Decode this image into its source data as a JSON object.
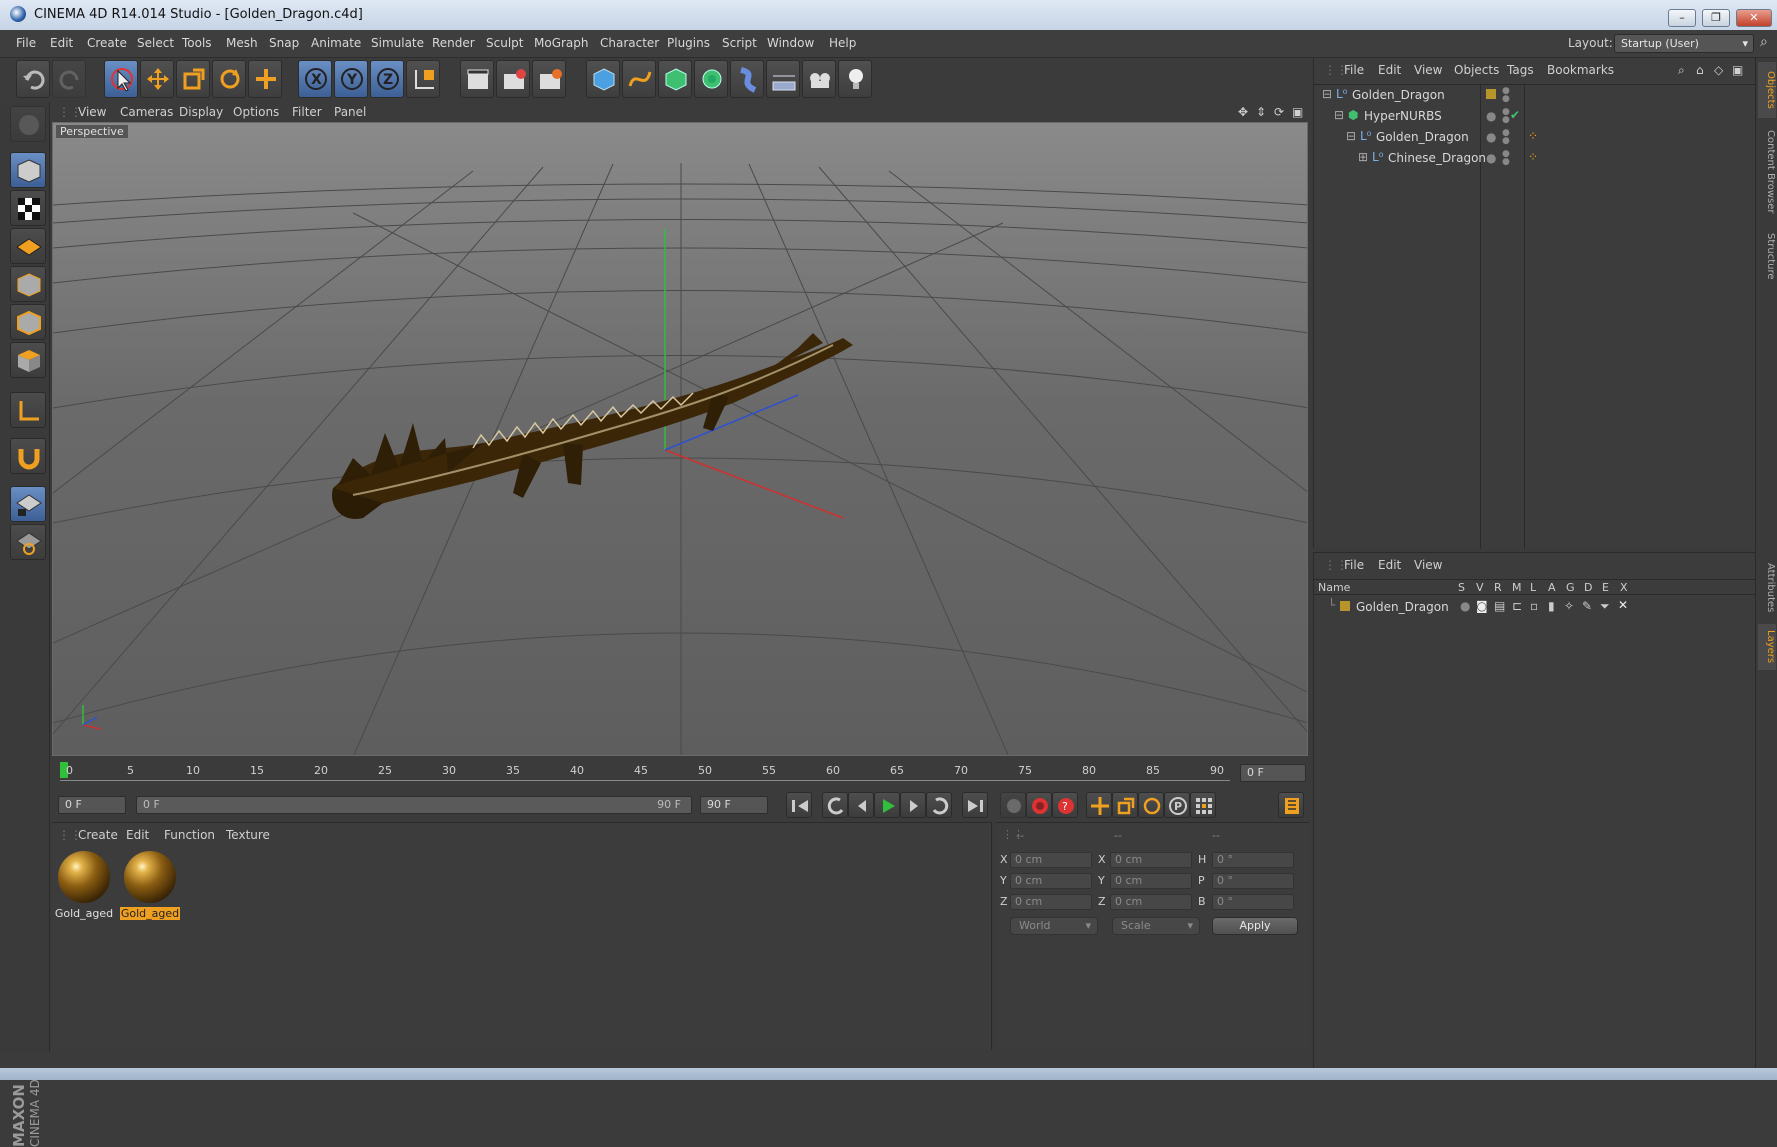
{
  "window": {
    "title": "CINEMA 4D R14.014 Studio - [Golden_Dragon.c4d]"
  },
  "menu": [
    "File",
    "Edit",
    "Create",
    "Select",
    "Tools",
    "Mesh",
    "Snap",
    "Animate",
    "Simulate",
    "Render",
    "Sculpt",
    "MoGraph",
    "Character",
    "Plugins",
    "Script",
    "Window",
    "Help"
  ],
  "layout": {
    "label": "Layout:",
    "value": "Startup (User)"
  },
  "viewport": {
    "menu": [
      "View",
      "Cameras",
      "Display",
      "Options",
      "Filter",
      "Panel"
    ],
    "label": "Perspective"
  },
  "timeline": {
    "ticks": [
      "0",
      "5",
      "10",
      "15",
      "20",
      "25",
      "30",
      "35",
      "40",
      "45",
      "50",
      "55",
      "60",
      "65",
      "70",
      "75",
      "80",
      "85",
      "90"
    ],
    "current_frame": "0 F"
  },
  "transport": {
    "start": "0 F",
    "range_start": "0 F",
    "range_end": "90 F",
    "end": "90 F"
  },
  "materials": {
    "menu": [
      "Create",
      "Edit",
      "Function",
      "Texture"
    ],
    "items": [
      {
        "name": "Gold_aged",
        "selected": false
      },
      {
        "name": "Gold_aged",
        "selected": true
      }
    ]
  },
  "coords": {
    "headers": [
      "--",
      "--",
      "--"
    ],
    "rows": [
      {
        "a": "X",
        "av": "0 cm",
        "b": "X",
        "bv": "0 cm",
        "c": "H",
        "cv": "0 °"
      },
      {
        "a": "Y",
        "av": "0 cm",
        "b": "Y",
        "bv": "0 cm",
        "c": "P",
        "cv": "0 °"
      },
      {
        "a": "Z",
        "av": "0 cm",
        "b": "Z",
        "bv": "0 cm",
        "c": "B",
        "cv": "0 °"
      }
    ],
    "space": "World",
    "mode": "Scale",
    "apply": "Apply"
  },
  "objects": {
    "menu": [
      "File",
      "Edit",
      "View",
      "Objects",
      "Tags",
      "Bookmarks"
    ],
    "tree": [
      {
        "name": "Golden_Dragon",
        "depth": 0
      },
      {
        "name": "HyperNURBS",
        "depth": 1
      },
      {
        "name": "Golden_Dragon",
        "depth": 2
      },
      {
        "name": "Chinese_Dragon",
        "depth": 3
      }
    ]
  },
  "layers": {
    "menu": [
      "File",
      "Edit",
      "View"
    ],
    "columns": [
      "Name",
      "S",
      "V",
      "R",
      "M",
      "L",
      "A",
      "G",
      "D",
      "E",
      "X"
    ],
    "rows": [
      {
        "name": "Golden_Dragon"
      }
    ]
  },
  "side_tabs": [
    "Objects",
    "Content Browser",
    "Structure",
    "Attributes",
    "Layers"
  ],
  "brand": {
    "line1": "MAXON",
    "line2": "CINEMA 4D"
  },
  "colors": {
    "accent": "#f0a020",
    "bg": "#3b3b3b",
    "active_blue": "#5a8ac8"
  }
}
